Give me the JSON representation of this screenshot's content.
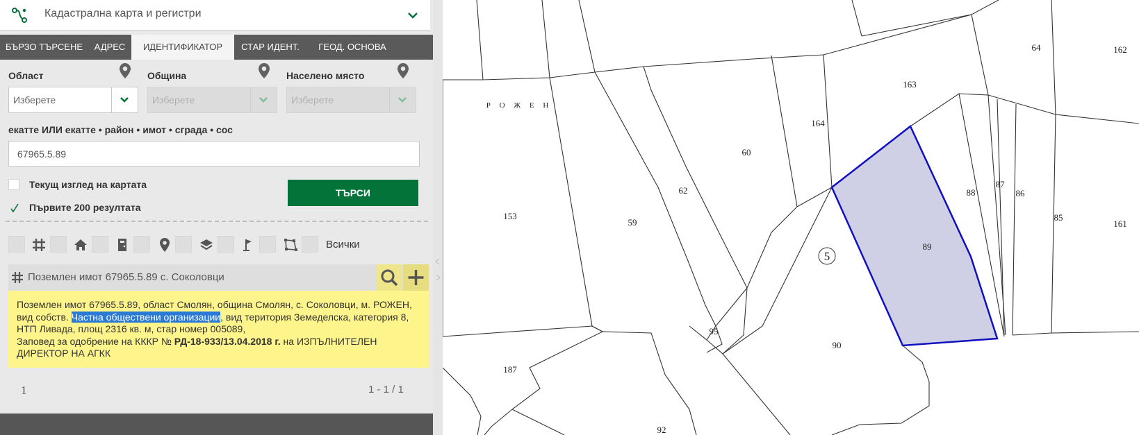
{
  "header": {
    "title": "Кадастрална карта и регистри",
    "logo_icon": "cadastre-route-icon",
    "accent": "#03733a"
  },
  "tabs": [
    {
      "label": "БЪРЗО ТЪРСЕНЕ",
      "active": false
    },
    {
      "label": "АДРЕС",
      "active": false
    },
    {
      "label": "ИДЕНТИФИКАТОР",
      "active": true
    },
    {
      "label": "СТАР ИДЕНТ.",
      "active": false
    },
    {
      "label": "ГЕОД. ОСНОВА",
      "active": false
    }
  ],
  "filters": {
    "oblast": {
      "label": "Област",
      "placeholder": "Изберете"
    },
    "obshtina": {
      "label": "Община",
      "placeholder": "Изберете"
    },
    "naseleno": {
      "label": "Населено място",
      "placeholder": "Изберете"
    }
  },
  "identifier": {
    "label": "екатте ИЛИ екатте • район • имот • сграда • сос",
    "value": "67965.5.89"
  },
  "options": {
    "current_view": {
      "label": "Текущ изглед на картата",
      "checked": false
    },
    "first200": {
      "label": "Първите 200 резултата",
      "checked": true
    }
  },
  "search_button": "ТЪРСИ",
  "layer_filter": {
    "all_label": "Всички"
  },
  "result": {
    "title": "Поземлен имот 67965.5.89 с. Соколовци",
    "desc_part1": "Поземлен имот 67965.5.89, област Смолян, община Смолян, с. Соколовци, м. РОЖЕН, вид собств. ",
    "desc_highlight": "Частна обществени организации",
    "desc_part2": ", вид територия Земеделска, категория 8, НТП Ливада, площ 2316 кв. м, стар номер 005089,",
    "desc_part3": "Заповед за одобрение на КККР № ",
    "order_no": "РД-18-933/13.04.2018 г.",
    "desc_part4": " на ИЗПЪЛНИТЕЛЕН ДИРЕКТОР НА АГКК"
  },
  "pagination": {
    "page": "1",
    "range": "1 - 1 / 1"
  },
  "map": {
    "locality_label": "Р О Ж Е Н",
    "selected_parcel": "89",
    "selected_fill": "#cfcfe6",
    "selected_stroke": "#1010c0",
    "block_marker": "5",
    "parcels": [
      "64",
      "162",
      "163",
      "164",
      "60",
      "62",
      "153",
      "59",
      "88",
      "87",
      "86",
      "85",
      "161",
      "89",
      "95",
      "90",
      "187",
      "92"
    ]
  }
}
